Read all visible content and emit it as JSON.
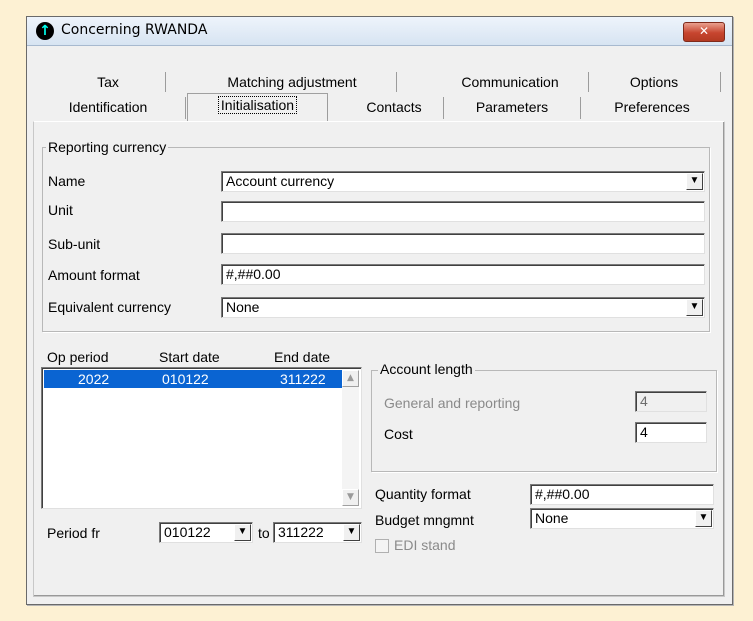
{
  "window": {
    "title": "Concerning RWANDA",
    "close_label": "✕"
  },
  "tabs_row1": [
    "Tax",
    "Matching adjustment",
    "Communication",
    "Options"
  ],
  "tabs_row2": [
    "Identification",
    "Initialisation",
    "Contacts",
    "Parameters",
    "Preferences"
  ],
  "active_tab": "Initialisation",
  "reporting_currency": {
    "legend": "Reporting currency",
    "name_label": "Name",
    "name_value": "Account currency",
    "unit_label": "Unit",
    "unit_value": "",
    "subunit_label": "Sub-unit",
    "subunit_value": "",
    "amount_format_label": "Amount format",
    "amount_format_value": "#,##0.00",
    "equivalent_label": "Equivalent currency",
    "equivalent_value": "None"
  },
  "periods": {
    "headers": [
      "Op period",
      "Start date",
      "End date"
    ],
    "rows": [
      {
        "period": "2022",
        "start": "010122",
        "end": "311222"
      }
    ],
    "period_from_label": "Period fr",
    "period_from_value": "010122",
    "to_label": "to",
    "period_to_value": "311222"
  },
  "account_length": {
    "legend": "Account length",
    "general_label": "General and reporting",
    "general_value": "4",
    "cost_label": "Cost",
    "cost_value": "4"
  },
  "quantity_format_label": "Quantity format",
  "quantity_format_value": "#,##0.00",
  "budget_label": "Budget mngmnt",
  "budget_value": "None",
  "edi_label": "EDI stand",
  "colors": {
    "selection": "#0a64d2",
    "background": "#fdf1d3"
  }
}
